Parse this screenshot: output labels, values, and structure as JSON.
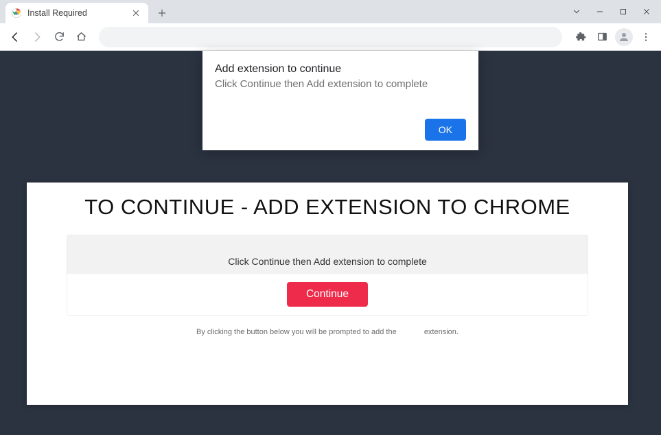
{
  "window": {
    "tab_title": "Install Required"
  },
  "toolbar": {
    "url": ""
  },
  "alert": {
    "title": "Add extension to continue",
    "subtitle": "Click Continue then Add extension to complete",
    "ok_label": "OK"
  },
  "page": {
    "headline": "TO CONTINUE - ADD EXTENSION TO CHROME",
    "panel_instruction": "Click Continue then Add extension to complete",
    "continue_label": "Continue",
    "disclaimer_before": "By clicking the button below you will be prompted to add the",
    "disclaimer_after": "extension."
  }
}
